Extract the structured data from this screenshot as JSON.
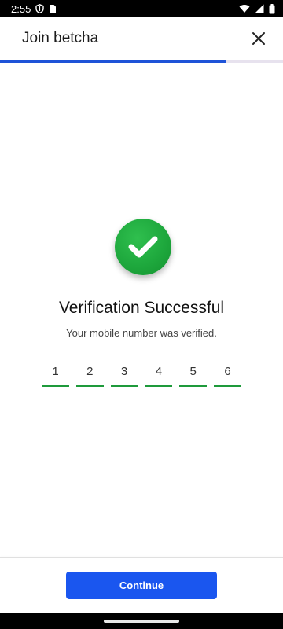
{
  "status_bar": {
    "time": "2:55",
    "icons": [
      "shield-icon",
      "sim-card-icon",
      "wifi-icon",
      "signal-icon",
      "battery-icon"
    ]
  },
  "app_bar": {
    "title": "Join betcha",
    "close_icon": "close-icon"
  },
  "progress": {
    "value": 0.8,
    "fill_color": "#1e53d8",
    "track_color": "#e7e2ee"
  },
  "verification": {
    "icon": "check-circle-icon",
    "icon_color": "#1ea83d",
    "title": "Verification Successful",
    "subtitle": "Your mobile number was verified.",
    "code_digits": [
      "1",
      "2",
      "3",
      "4",
      "5",
      "6"
    ]
  },
  "footer": {
    "continue_label": "Continue",
    "button_color": "#1a56ef"
  }
}
